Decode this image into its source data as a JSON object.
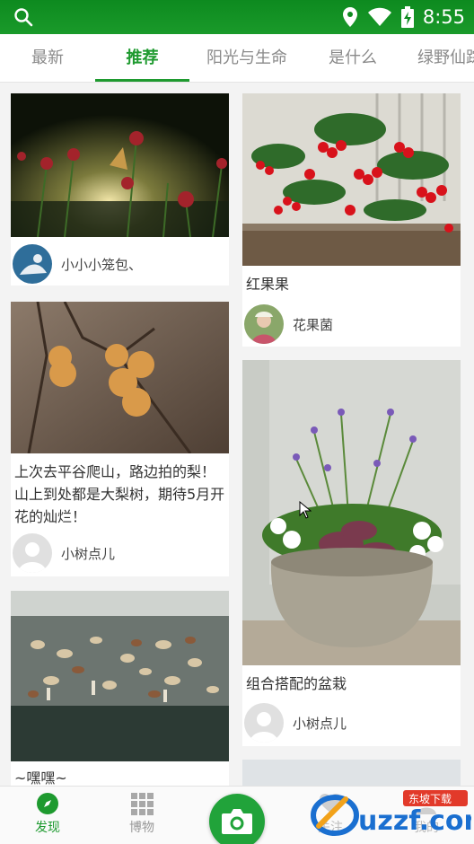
{
  "status": {
    "time": "8:55"
  },
  "tabs": [
    "最新",
    "推荐",
    "阳光与生命",
    "是什么",
    "绿野仙踪"
  ],
  "active_tab": "推荐",
  "cards": [
    {
      "title": "",
      "user": "小小小笼包、"
    },
    {
      "title": "红果果",
      "user": "花果菌"
    },
    {
      "title": "上次去平谷爬山，路边拍的梨！山上到处都是大梨树，期待5月开花的灿烂！",
      "user": "小树点儿"
    },
    {
      "title": "组合搭配的盆栽",
      "user": "小树点儿"
    },
    {
      "title": "~嘿嘿~",
      "user": ""
    }
  ],
  "bottom_nav": {
    "discover": "发现",
    "museum": "博物",
    "follow": "关注",
    "mine": "我的"
  },
  "watermark": {
    "brand": "uzzf.com",
    "tag": "东坡下载"
  },
  "colors": {
    "accent": "#1e9a2f",
    "status_bar": "#0d8a1f"
  }
}
